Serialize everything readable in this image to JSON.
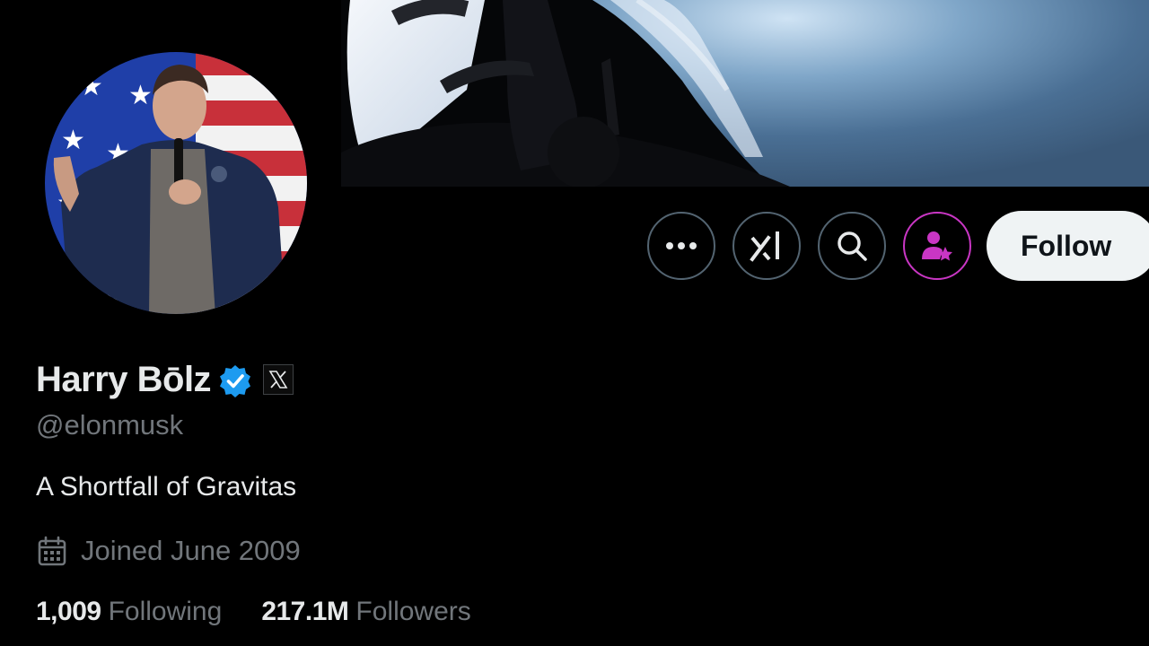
{
  "profile": {
    "display_name": "Harry Bōlz",
    "handle": "@elonmusk",
    "bio": "A Shortfall of Gravitas",
    "joined": "Joined June 2009",
    "following_count": "1,009",
    "following_label": "Following",
    "followers_count": "217.1M",
    "followers_label": "Followers"
  },
  "actions": {
    "more_icon": "more-icon",
    "grok_icon": "xai-icon",
    "search_icon": "search-icon",
    "subscribe_icon": "person-star-icon",
    "follow_label": "Follow"
  },
  "colors": {
    "background": "#000000",
    "text_primary": "#e7e9ea",
    "text_secondary": "#71767b",
    "verified_blue": "#1d9bf0",
    "subscribe_purple": "#c936c4",
    "follow_button_bg": "#eff3f4"
  }
}
